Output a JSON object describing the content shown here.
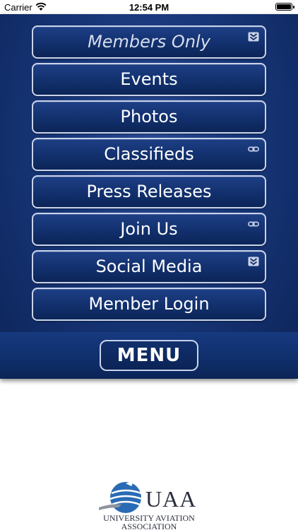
{
  "status_bar": {
    "carrier": "Carrier",
    "time": "12:54 PM"
  },
  "menu": {
    "items": [
      {
        "label": "Members Only",
        "icon": "chevron-double-down-icon",
        "style": "italic"
      },
      {
        "label": "Events",
        "icon": ""
      },
      {
        "label": "Photos",
        "icon": ""
      },
      {
        "label": "Classifieds",
        "icon": "link-icon"
      },
      {
        "label": "Press Releases",
        "icon": ""
      },
      {
        "label": "Join Us",
        "icon": "link-icon"
      },
      {
        "label": "Social Media",
        "icon": "chevron-double-down-icon"
      },
      {
        "label": "Member Login",
        "icon": ""
      }
    ],
    "menu_button_label": "MENU"
  },
  "logo": {
    "acronym": "UAA",
    "line1": "UNIVERSITY AVIATION",
    "line2": "ASSOCIATION"
  },
  "colors": {
    "panel_blue": "#173679",
    "button_border": "#c9d3ea",
    "text_white": "#ffffff"
  }
}
